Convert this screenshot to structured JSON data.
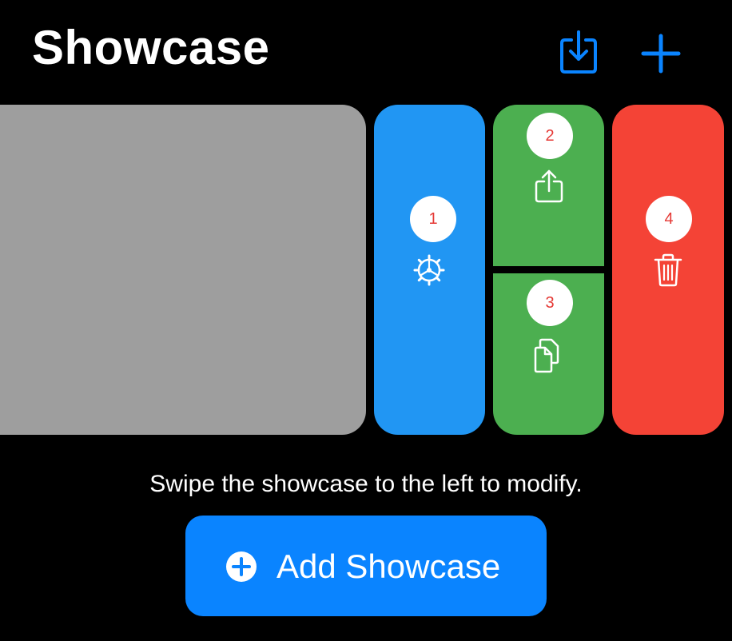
{
  "header": {
    "title": "Showcase",
    "import_icon": "tray-arrow-down-icon",
    "add_icon": "plus-icon"
  },
  "actions": [
    {
      "badge": "1",
      "icon": "gear-icon",
      "color": "#2196f3"
    },
    {
      "badge": "2",
      "icon": "share-icon",
      "color": "#4caf50"
    },
    {
      "badge": "3",
      "icon": "duplicate-icon",
      "color": "#4caf50"
    },
    {
      "badge": "4",
      "icon": "trash-icon",
      "color": "#f44336"
    }
  ],
  "card": {
    "color": "#9e9e9e"
  },
  "hint": "Swipe the showcase to the left to modify.",
  "add_button": {
    "label": "Add Showcase",
    "icon": "plus-circle-icon",
    "color": "#0a84ff"
  },
  "colors": {
    "accent": "#0a84ff",
    "badge_text": "#e53935"
  }
}
